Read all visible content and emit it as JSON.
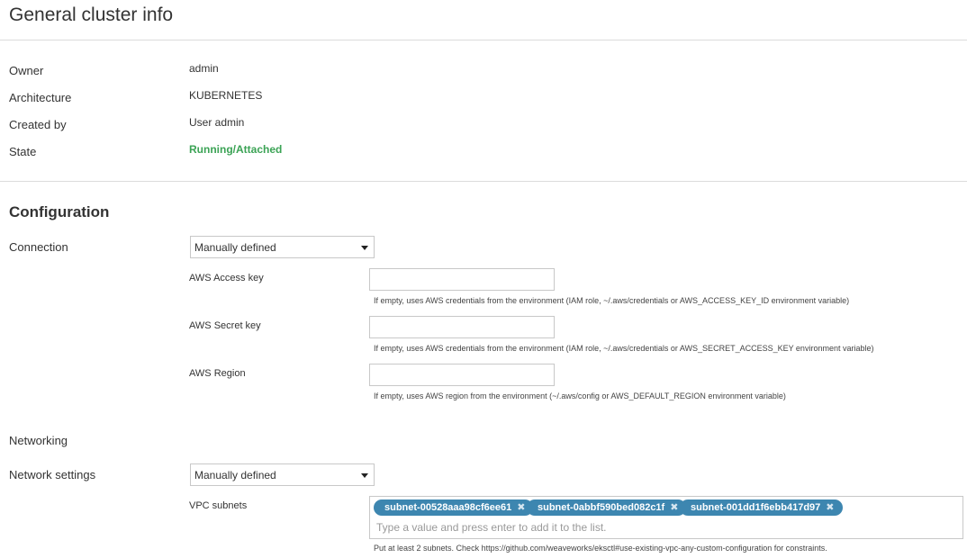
{
  "page_title": "General cluster info",
  "general": {
    "rows": [
      {
        "label": "Owner",
        "value": "admin"
      },
      {
        "label": "Architecture",
        "value": "KUBERNETES"
      },
      {
        "label": "Created by",
        "value": "User admin"
      },
      {
        "label": "State",
        "value": "Running/Attached"
      }
    ],
    "state_color": "#3ba355"
  },
  "configuration": {
    "title": "Configuration",
    "connection_label": "Connection",
    "connection_value": "Manually defined",
    "aws_access_key": {
      "label": "AWS Access key",
      "value": "",
      "help": "If empty, uses AWS credentials from the environment (IAM role, ~/.aws/credentials or AWS_ACCESS_KEY_ID environment variable)"
    },
    "aws_secret_key": {
      "label": "AWS Secret key",
      "value": "",
      "help": "If empty, uses AWS credentials from the environment (IAM role, ~/.aws/credentials or AWS_SECRET_ACCESS_KEY environment variable)"
    },
    "aws_region": {
      "label": "AWS Region",
      "value": "",
      "help": "If empty, uses AWS region from the environment (~/.aws/config or AWS_DEFAULT_REGION environment variable)"
    }
  },
  "networking": {
    "title": "Networking",
    "network_settings_label": "Network settings",
    "network_settings_value": "Manually defined",
    "vpc_subnets_label": "VPC subnets",
    "subnets": [
      "subnet-00528aaa98cf6ee61",
      "subnet-0abbf590bed082c1f",
      "subnet-001dd1f6ebb417d97"
    ],
    "subnet_input_placeholder": "Type a value and press enter to add it to the list.",
    "subnets_help": "Put at least 2 subnets. Check https://github.com/weaveworks/eksctl#use-existing-vpc-any-custom-configuration for constraints."
  },
  "colors": {
    "tag_background": "#3d86b0",
    "divider": "#dcdcdc"
  }
}
